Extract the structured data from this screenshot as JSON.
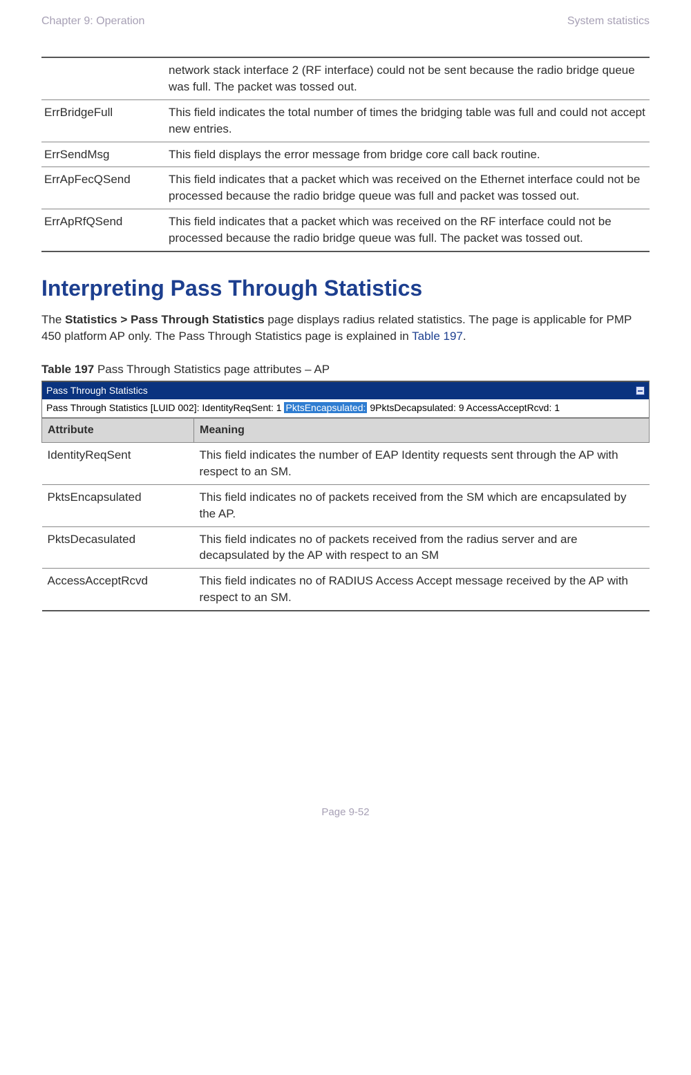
{
  "header": {
    "left": "Chapter 9:  Operation",
    "right": "System statistics"
  },
  "table1": {
    "rows": [
      {
        "attr": "",
        "desc": "network stack interface 2 (RF interface) could not be sent because the radio bridge queue was full. The packet was tossed out."
      },
      {
        "attr": "ErrBridgeFull",
        "desc": "This field indicates the total number of times the bridging table was full and could not accept new entries."
      },
      {
        "attr": "ErrSendMsg",
        "desc": " This field displays the error message from bridge core call back routine."
      },
      {
        "attr": "ErrApFecQSend",
        "desc": "This field indicates that a packet which was received on the Ethernet interface could not be processed because the radio bridge queue was full and packet was tossed out."
      },
      {
        "attr": "ErrApRfQSend",
        "desc": "This field indicates that a packet which was received on the RF interface could not be processed because the radio bridge queue was full. The packet was tossed out."
      }
    ]
  },
  "section": {
    "title": "Interpreting Pass Through Statistics",
    "para_pre": "The ",
    "breadcrumb": "Statistics > Pass Through Statistics",
    "para_mid": " page displays radius related statistics. The page is applicable for PMP 450 platform AP only. The Pass Through Statistics page is explained in ",
    "xref": "Table 197",
    "para_post": "."
  },
  "table2": {
    "caption_bold": "Table 197",
    "caption_rest": " Pass Through Statistics page attributes – AP",
    "panel_title": "Pass Through Statistics",
    "panel_prefix": "Pass Through Statistics [LUID 002]: IdentityReqSent: 1 ",
    "panel_highlight": "PktsEncapsulated:",
    "panel_suffix": " 9PktsDecapsulated: 9 AccessAcceptRcvd: 1",
    "th1": "Attribute",
    "th2": "Meaning",
    "rows": [
      {
        "attr": "IdentityReqSent",
        "desc": "This field indicates the number of EAP Identity requests sent through the AP with respect to an SM."
      },
      {
        "attr": "PktsEncapsulated",
        "desc": "This field indicates no of packets received from the SM which are encapsulated by the AP."
      },
      {
        "attr": "PktsDecasulated",
        "desc": "This field indicates no of packets received from the radius server and are decapsulated by the AP with respect to an SM"
      },
      {
        "attr": "AccessAcceptRcvd",
        "desc": "This field indicates no of RADIUS Access Accept message received by the AP with respect to an SM."
      }
    ]
  },
  "footer": "Page 9-52",
  "chart_data": {
    "type": "table",
    "title": "Pass Through Statistics [LUID 002]",
    "fields": [
      "IdentityReqSent",
      "PktsEncapsulated",
      "PktsDecapsulated",
      "AccessAcceptRcvd"
    ],
    "values": [
      1,
      9,
      9,
      1
    ]
  }
}
